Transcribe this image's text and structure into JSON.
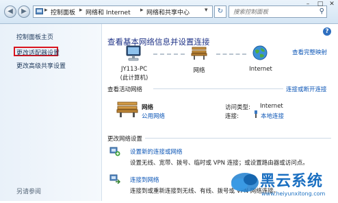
{
  "breadcrumb": {
    "items": [
      "控制面板",
      "网络和 Internet",
      "网络和共享中心"
    ]
  },
  "search": {
    "placeholder": "搜索控制面板"
  },
  "sidebar": {
    "items": [
      {
        "label": "控制面板主页"
      },
      {
        "label": "更改适配器设置"
      },
      {
        "label": "更改高级共享设置"
      }
    ],
    "see_also": "另请参阅"
  },
  "main": {
    "title": "查看基本网络信息并设置连接",
    "full_map_link": "查看完整映射",
    "map": {
      "computer_name": "JY113-PC",
      "computer_sub": "(此计算机)",
      "network_label": "网络",
      "internet_label": "Internet"
    },
    "active": {
      "heading": "查看活动网络",
      "connect_link": "连接或断开连接",
      "network_name": "网络",
      "network_type": "公用网络",
      "access_type_label": "访问类型:",
      "access_type_value": "Internet",
      "connection_label": "连接:",
      "connection_value": "本地连接"
    },
    "settings": {
      "heading": "更改网络设置",
      "tasks": [
        {
          "title": "设置新的连接或网络",
          "desc": "设置无线、宽带、拨号、临时或 VPN 连接；或设置路由器或访问点。"
        },
        {
          "title": "连接到网络",
          "desc": "连接到或重新连接到无线、有线、拨号或 VPN 网络连接。"
        }
      ]
    }
  },
  "watermark": {
    "text": "黑云系统",
    "url": "www.heiyunxitong.com"
  },
  "colors": {
    "link": "#0b55b6",
    "title": "#1e3287",
    "highlight": "#d9141e"
  }
}
